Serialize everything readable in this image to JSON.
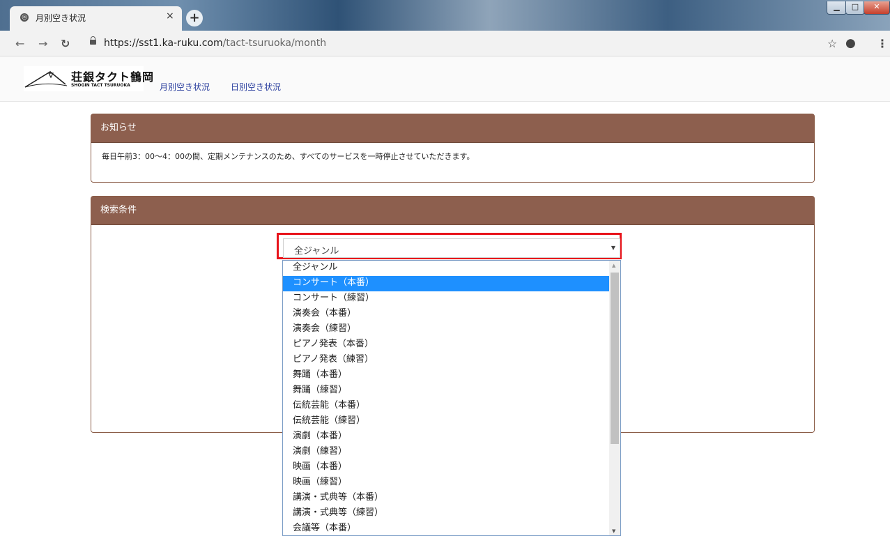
{
  "browser": {
    "tab_title": "月別空き状況",
    "close_glyph": "×",
    "newtab_glyph": "+",
    "url_host": "https://sst1.ka-ruku.com",
    "url_path": "/tact-tsuruoka/month",
    "icons": [
      "globe-icon",
      "back-icon",
      "forward-icon",
      "reload-icon",
      "lock-icon",
      "star-icon",
      "account-icon",
      "menu-icon"
    ]
  },
  "site": {
    "logo_jp": "荘銀タクト鶴岡",
    "logo_en": "SHOGIN TACT TSURUOKA",
    "nav": [
      "月別空き状況",
      "日別空き状況"
    ]
  },
  "notice": {
    "title": "お知らせ",
    "text": "毎日午前3：00〜4：00の間、定期メンテナンスのため、すべてのサービスを一時停止させていただきます。"
  },
  "search": {
    "title": "検索条件",
    "selected": "全ジャンル",
    "highlight_color": "#e8141b",
    "options": [
      "全ジャンル",
      "コンサート（本番）",
      "コンサート（練習）",
      "演奏会（本番）",
      "演奏会（練習）",
      "ピアノ発表（本番）",
      "ピアノ発表（練習）",
      "舞踊（本番）",
      "舞踊（練習）",
      "伝統芸能（本番）",
      "伝統芸能（練習）",
      "演劇（本番）",
      "演劇（練習）",
      "映画（本番）",
      "映画（練習）",
      "講演・式典等（本番）",
      "講演・式典等（練習）",
      "会議等（本番）"
    ],
    "hovered_option": "コンサート（本番）"
  }
}
